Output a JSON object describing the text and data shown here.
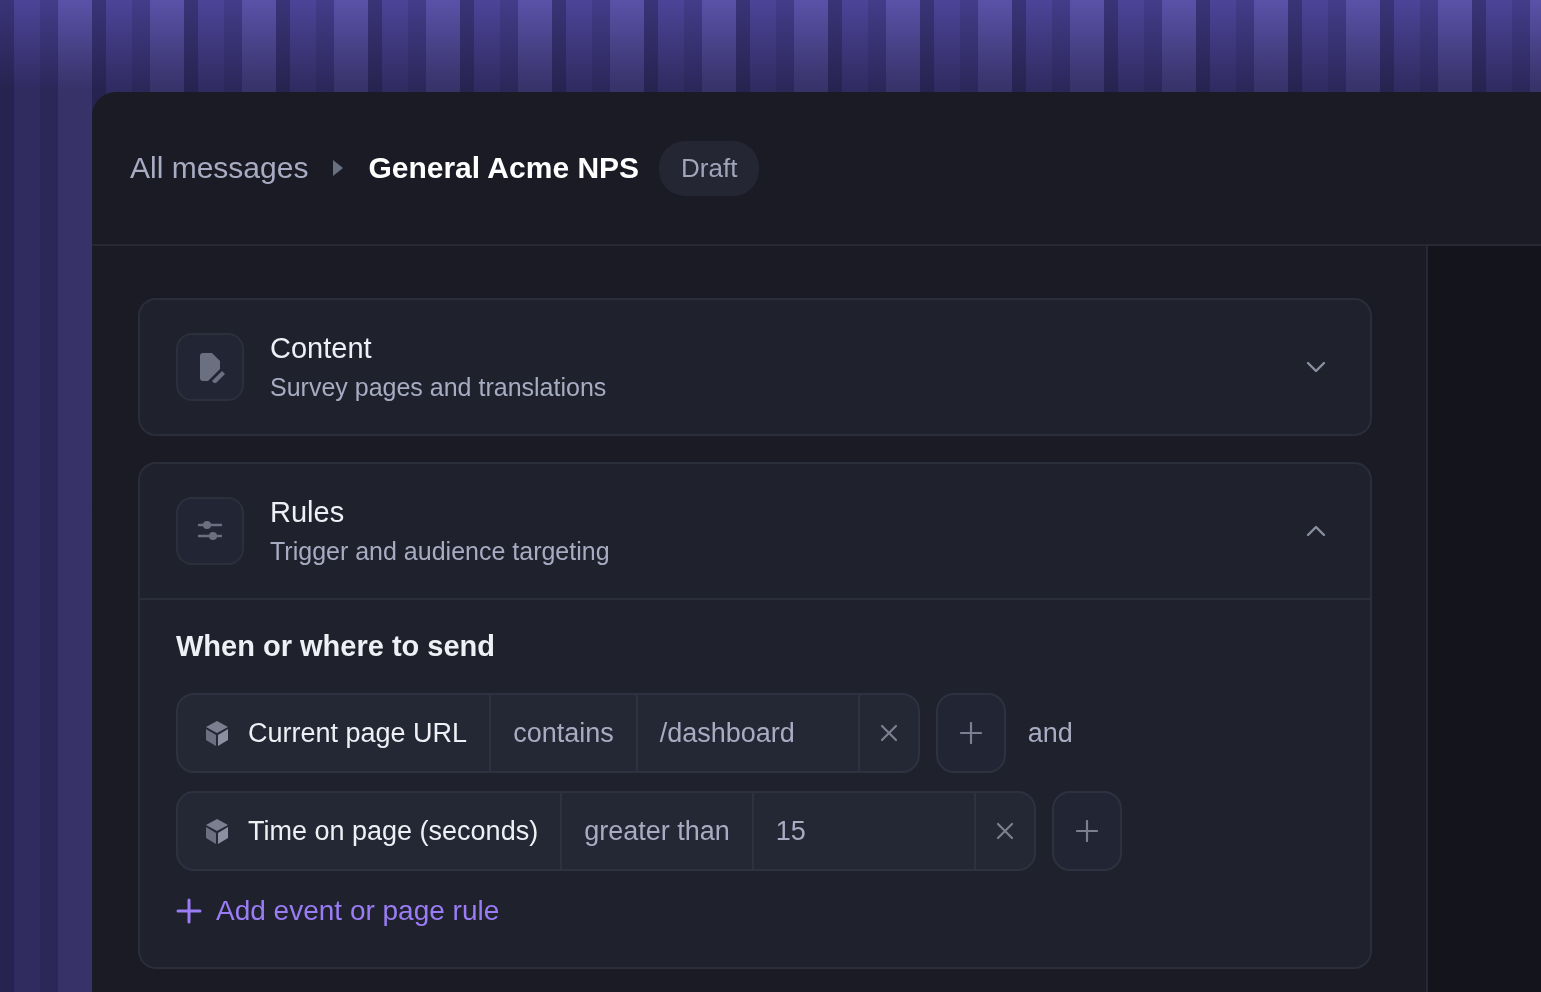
{
  "breadcrumb": {
    "parent": "All messages",
    "current": "General Acme NPS",
    "status": "Draft"
  },
  "sections": [
    {
      "kind": "content",
      "title": "Content",
      "subtitle": "Survey pages and translations",
      "expanded": false
    },
    {
      "kind": "rules",
      "title": "Rules",
      "subtitle": "Trigger and audience targeting",
      "expanded": true,
      "heading": "When or where to send",
      "rules": [
        {
          "property": "Current page URL",
          "operator": "contains",
          "value": "/dashboard",
          "connector": "and"
        },
        {
          "property": "Time on page (seconds)",
          "operator": "greater than",
          "value": "15"
        }
      ],
      "add_label": "Add event or page rule"
    }
  ]
}
